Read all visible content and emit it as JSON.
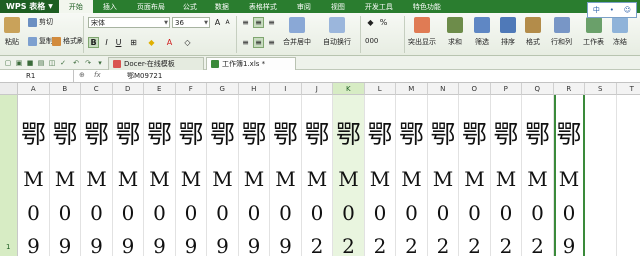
{
  "app": {
    "brand": "WPS 表格",
    "input_method": [
      "中",
      "•",
      "☺"
    ]
  },
  "menu": [
    "开始",
    "插入",
    "页面布局",
    "公式",
    "数据",
    "表格样式",
    "审阅",
    "视图",
    "开发工具",
    "特色功能"
  ],
  "ribbon": {
    "paste": "粘贴",
    "cut": "剪切",
    "copy": "复制",
    "format_painter": "格式刷",
    "font_name": "宋体",
    "font_size": "36",
    "bold": "B",
    "italic": "I",
    "underline": "U",
    "merge_center": "合并居中",
    "auto_wrap": "自动换行",
    "percent": "%",
    "thousands": "000",
    "cond_format": "突出显示",
    "sum": "求和",
    "filter": "筛选",
    "sort": "排序",
    "format": "格式",
    "rows_cols": "行和列",
    "worksheet": "工作表",
    "freeze": "冻结"
  },
  "tabs": [
    {
      "label": "Docer-在线模板"
    },
    {
      "label": "工作簿1.xls *"
    }
  ],
  "formula_bar": {
    "cell_ref": "R1",
    "fx": "fx",
    "value": "鄂M09721"
  },
  "grid": {
    "columns": [
      "A",
      "B",
      "C",
      "D",
      "E",
      "F",
      "G",
      "H",
      "I",
      "J",
      "K",
      "L",
      "M",
      "N",
      "O",
      "P",
      "Q",
      "R",
      "S",
      "T"
    ],
    "selected_column": "K",
    "active_column": "R",
    "row_label": "1",
    "lines": [
      "鄂",
      "M",
      "0",
      "9"
    ],
    "last_line_values": [
      "9",
      "9",
      "9",
      "9",
      "9",
      "9",
      "9",
      "9",
      "9",
      "2",
      "2",
      "2",
      "2",
      "2",
      "2",
      "2",
      "2",
      "9"
    ]
  },
  "colors": {
    "menu_bg": "#2a7d2f",
    "brand_bg": "#1d5e22",
    "selection": "#d7ecc4"
  }
}
